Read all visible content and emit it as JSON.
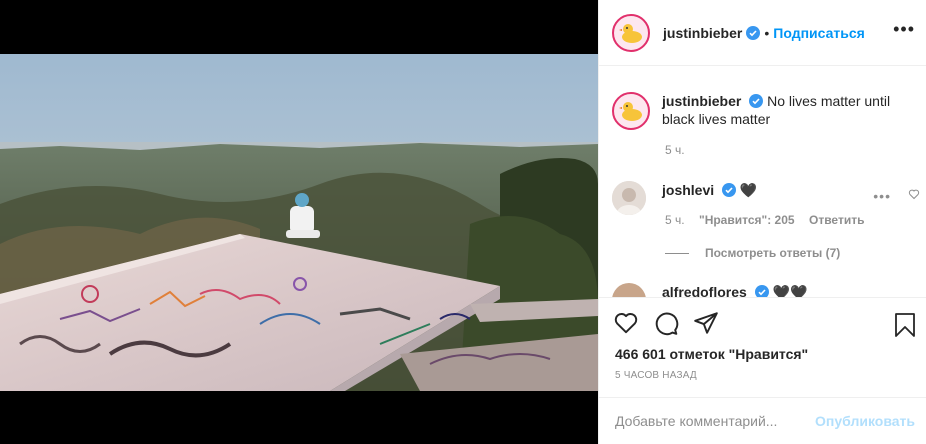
{
  "post": {
    "author": "justinbieber",
    "follow_label": "Подписаться",
    "dot": "•",
    "more_icon": "more-horizontal-icon"
  },
  "caption": {
    "username": "justinbieber",
    "text": "No lives matter until black lives matter",
    "time": "5 ч."
  },
  "comments": [
    {
      "username": "joshlevi",
      "text": "🖤",
      "time": "5 ч.",
      "likes": "\"Нравится\": 205",
      "reply_label": "Ответить",
      "view_replies": "Посмотреть ответы (7)"
    },
    {
      "username": "alfredoflores",
      "text": "🖤🖤"
    }
  ],
  "actions": {
    "like_icon": "heart-icon",
    "comment_icon": "comment-icon",
    "share_icon": "share-icon",
    "save_icon": "bookmark-icon",
    "likes_text": "466 601 отметок \"Нравится\"",
    "posted_ago": "5 ЧАСОВ НАЗАД"
  },
  "composer": {
    "placeholder": "Добавьте комментарий...",
    "publish_label": "Опубликовать"
  },
  "colors": {
    "accent": "#0095f6",
    "muted": "#8e8e8e",
    "publish_disabled": "#b2dffc",
    "verified": "#3897f0"
  }
}
